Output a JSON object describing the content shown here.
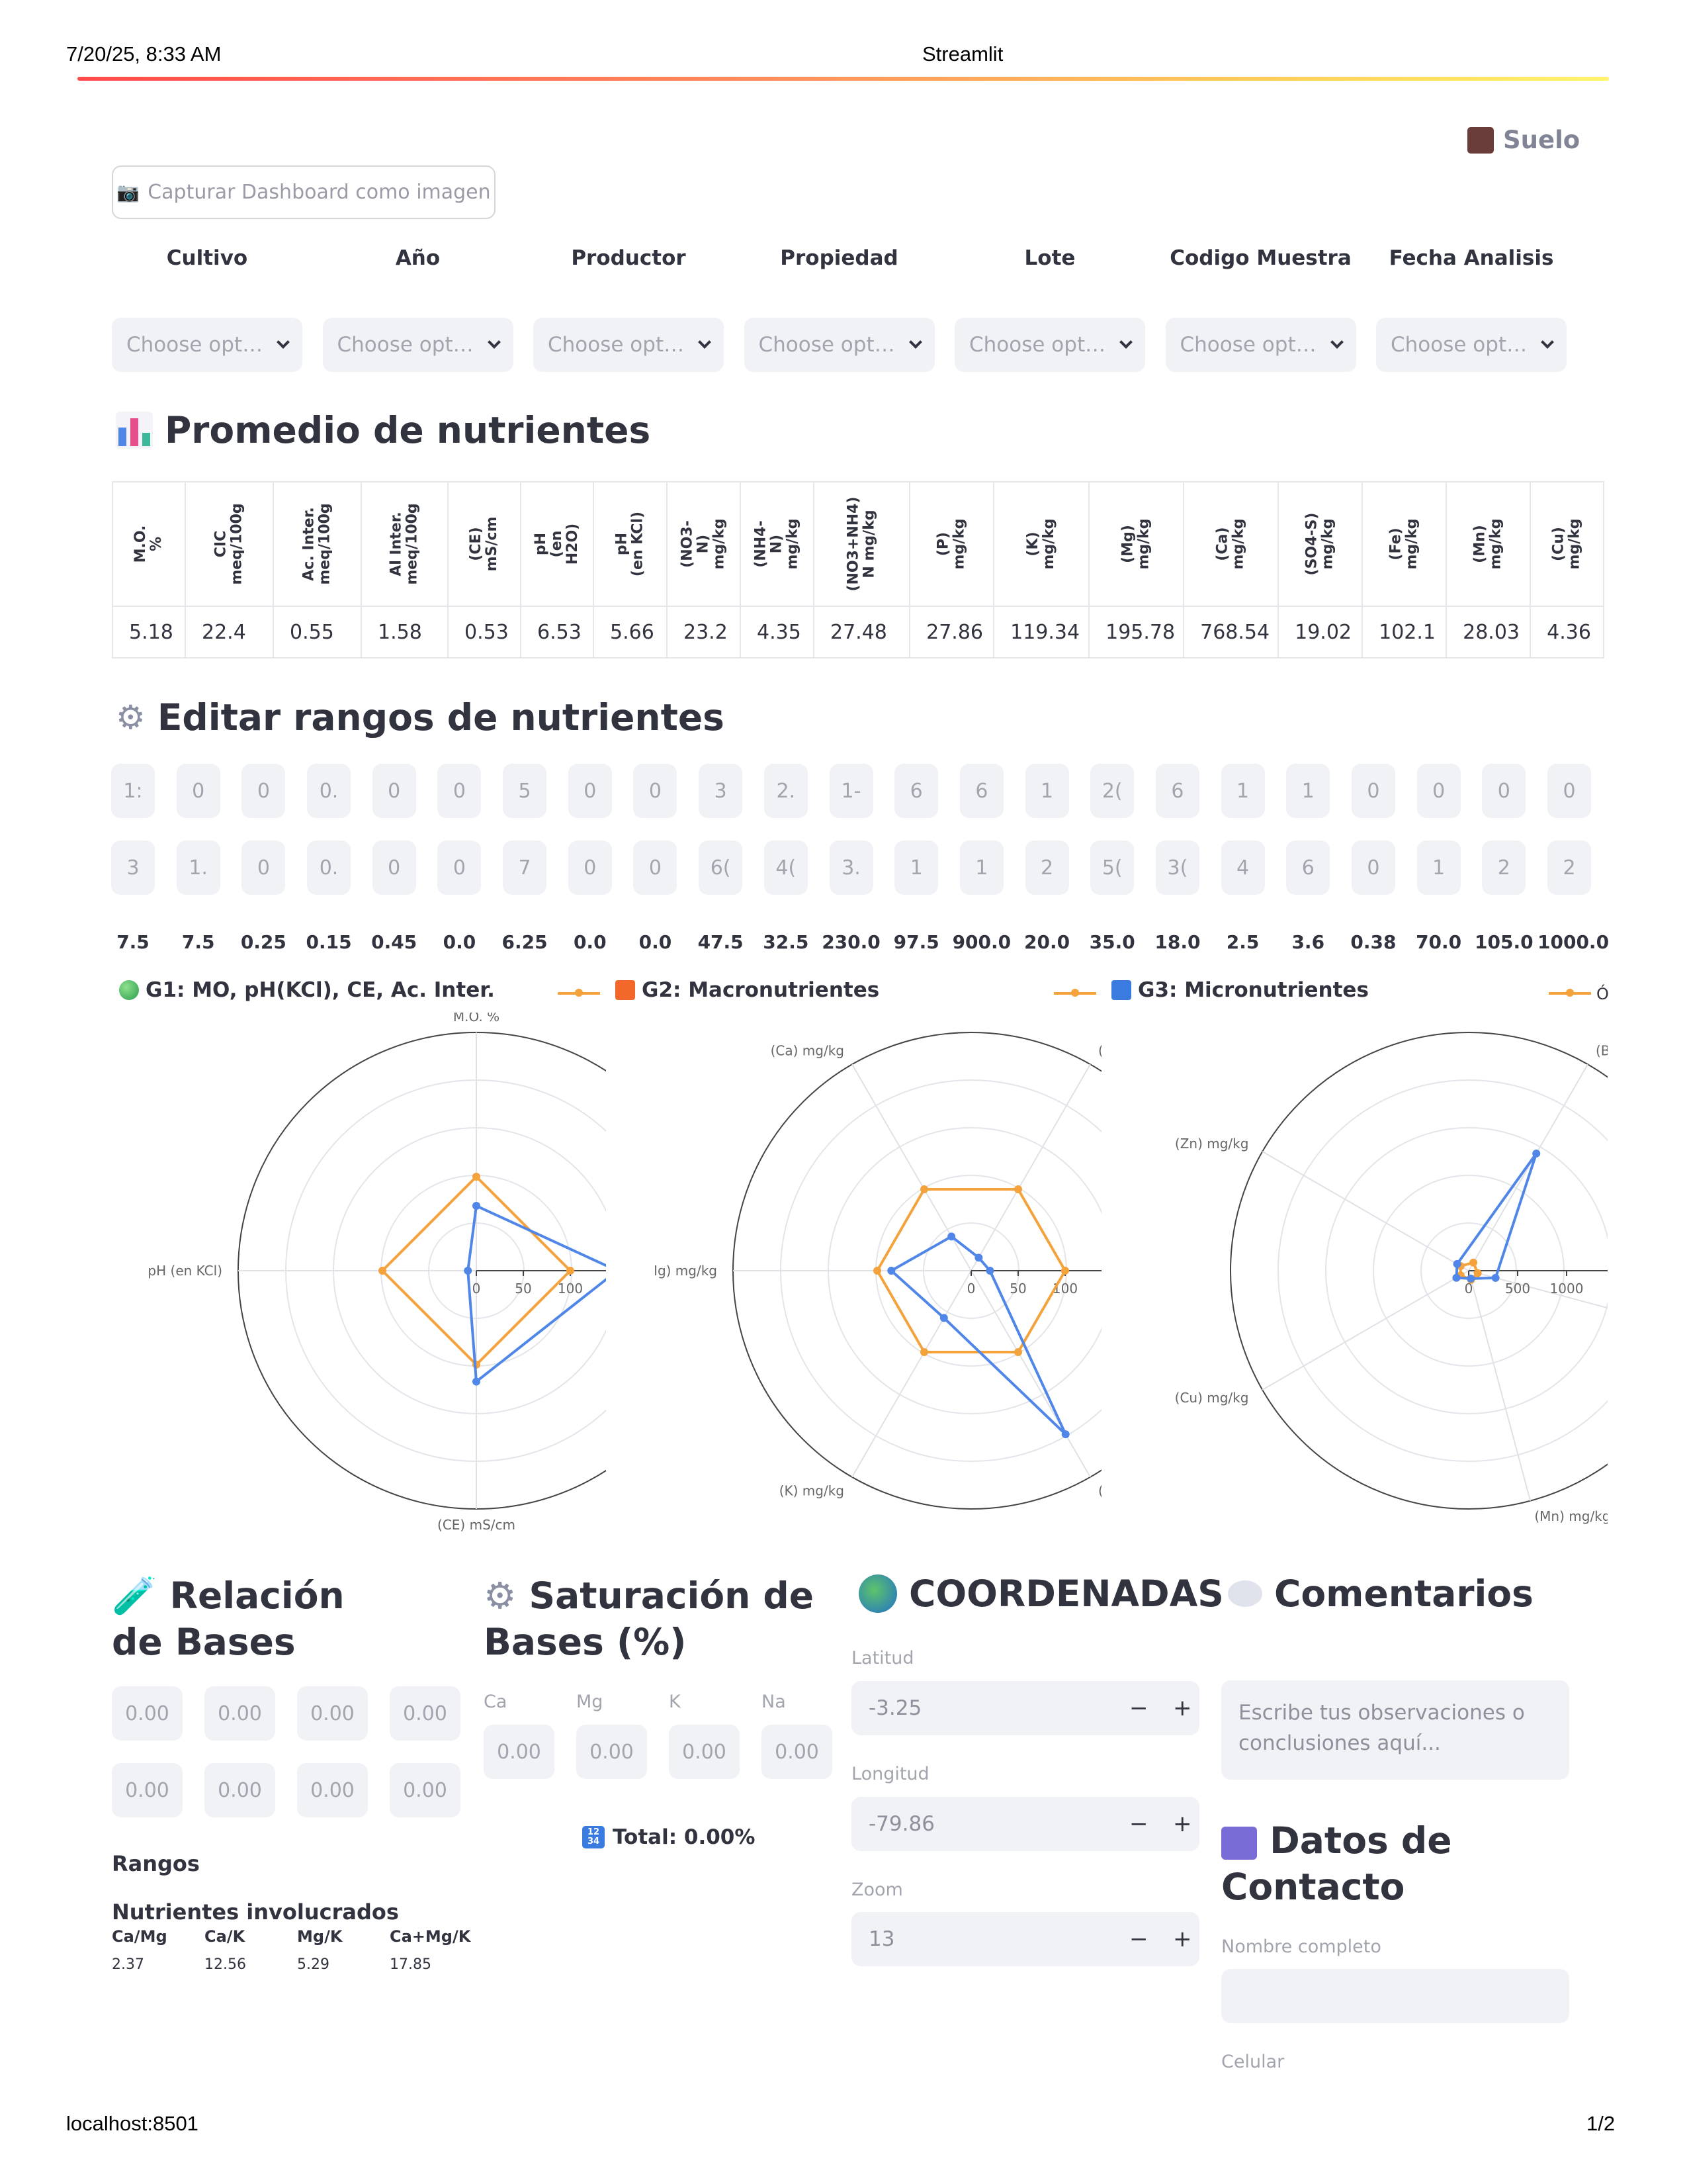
{
  "print": {
    "datetime": "7/20/25, 8:33 AM",
    "title": "Streamlit",
    "url": "localhost:8501",
    "page": "1/2"
  },
  "header": {
    "suelo_label": "Suelo",
    "capture_button": "Capturar Dashboard como imagen"
  },
  "filters": [
    {
      "label": "Cultivo",
      "placeholder": "Choose opt…"
    },
    {
      "label": "Año",
      "placeholder": "Choose opt…"
    },
    {
      "label": "Productor",
      "placeholder": "Choose opt…"
    },
    {
      "label": "Propiedad",
      "placeholder": "Choose opt…"
    },
    {
      "label": "Lote",
      "placeholder": "Choose opt…"
    },
    {
      "label": "Codigo Muestra",
      "placeholder": "Choose opt…"
    },
    {
      "label": "Fecha Analisis",
      "placeholder": "Choose opt…"
    }
  ],
  "promedio": {
    "title": "Promedio de nutrientes",
    "columns": [
      "M.O.\n%",
      "CIC\nmeq/100g",
      "Ac. Inter.\nmeq/100g",
      "Al Inter.\nmeq/100g",
      "(CE)\nmS/cm",
      "pH\n(en\nH2O)",
      "pH\n(en KCl)",
      "(NO3-\nN)\nmg/kg",
      "(NH4-\nN)\nmg/kg",
      "(NO3+NH4)\nN mg/kg",
      "(P)\nmg/kg",
      "(K)\nmg/kg",
      "(Mg)\nmg/kg",
      "(Ca)\nmg/kg",
      "(SO4-S)\nmg/kg",
      "(Fe)\nmg/kg",
      "(Mn)\nmg/kg",
      "(Cu)\nmg/kg"
    ],
    "values": [
      "5.18",
      "22.4",
      "0.55",
      "1.58",
      "0.53",
      "6.53",
      "5.66",
      "23.2",
      "4.35",
      "27.48",
      "27.86",
      "119.34",
      "195.78",
      "768.54",
      "19.02",
      "102.1",
      "28.03",
      "4.36"
    ]
  },
  "rangos_edit": {
    "title": "Editar rangos de nutrientes",
    "row_min": [
      "1:",
      "0",
      "0",
      "0.",
      "0",
      "0",
      "5",
      "0",
      "0",
      "3",
      "2.",
      "1-",
      "6",
      "6",
      "1",
      "2(",
      "6",
      "1",
      "1",
      "0",
      "0",
      "0",
      "0"
    ],
    "row_max": [
      "3",
      "1.",
      "0",
      "0.",
      "0",
      "0",
      "7",
      "0",
      "0",
      "6(",
      "4(",
      "3.",
      "1",
      "1",
      "2",
      "5(",
      "3(",
      "4",
      "6",
      "0",
      "1",
      "2",
      "2"
    ],
    "optimos": [
      "7.5",
      "7.5",
      "0.25",
      "0.15",
      "0.45",
      "0.0",
      "6.25",
      "0.0",
      "0.0",
      "47.5",
      "32.5",
      "230.0",
      "97.5",
      "900.0",
      "20.0",
      "35.0",
      "18.0",
      "2.5",
      "3.6",
      "0.38",
      "70.0",
      "105.0",
      "1000.0"
    ]
  },
  "radar_titles": {
    "g1": "G1: MO, pH(KCl), CE, Ac. Inter.",
    "g2": "G2: Macronutrientes",
    "g3": "G3: Micronutrientes",
    "g3_legend_clip": "Ó"
  },
  "chart_data": [
    {
      "type": "radar",
      "title": "G1: MO, pH(KCl), CE, Ac. Inter.",
      "axes": [
        "M.O. %",
        "pH  (en KCl)",
        "(CE) mS/cm"
      ],
      "radial_ticks": [
        "0",
        "50",
        "100"
      ],
      "series": [
        {
          "name": "Óptimo",
          "values": [
            100,
            100,
            100,
            100
          ],
          "color": "#f4a23c"
        },
        {
          "values": [
            69,
            9,
            118,
            150
          ],
          "color": "#4f86e8"
        }
      ]
    },
    {
      "type": "radar",
      "title": "G2: Macronutrientes",
      "axes": [
        "(Ca) mg/kg",
        "(S",
        "(Mg) mg/kg",
        "(K) mg/kg",
        "(P"
      ],
      "radial_ticks": [
        "0",
        "50",
        "100"
      ],
      "series": [
        {
          "name": "Óptimo",
          "values": [
            100,
            100,
            100,
            100,
            100,
            100
          ],
          "color": "#f4a23c"
        },
        {
          "values": [
            42,
            16,
            20,
            201,
            58,
            85
          ],
          "color": "#4f86e8"
        }
      ]
    },
    {
      "type": "radar",
      "title": "G3: Micronutrientes",
      "axes": [
        "(B)  mg/kg",
        "(Zn)  mg/kg",
        "(Cu) mg/kg",
        "(Mn) mg/kg"
      ],
      "radial_ticks": [
        "0",
        "500",
        "1000",
        "1"
      ],
      "series": [
        {
          "name": "Óptimo",
          "values": [
            100,
            100,
            100,
            100,
            100
          ],
          "color": "#f4a23c"
        },
        {
          "values": [
            1450,
            143,
            152,
            87,
            298
          ],
          "color": "#4f86e8"
        }
      ]
    }
  ],
  "relacion": {
    "title": "Relación de Bases",
    "inputs": [
      "0.00",
      "0.00",
      "0.00",
      "0.00",
      "0.00",
      "0.00",
      "0.00",
      "0.00"
    ],
    "rangos_label": "Rangos",
    "nutrientes_label": "Nutrientes involucrados",
    "ratios": [
      {
        "name": "Ca/Mg",
        "value": "2.37"
      },
      {
        "name": "Ca/K",
        "value": "12.56"
      },
      {
        "name": "Mg/K",
        "value": "5.29"
      },
      {
        "name": "Ca+Mg/K",
        "value": "17.85"
      }
    ]
  },
  "saturacion": {
    "title": "Saturación de Bases (%)",
    "fields": [
      {
        "label": "Ca",
        "value": "0.00"
      },
      {
        "label": "Mg",
        "value": "0.00"
      },
      {
        "label": "K",
        "value": "0.00"
      },
      {
        "label": "Na",
        "value": "0.00"
      }
    ],
    "total": "Total: 0.00%"
  },
  "coordenadas": {
    "title": "COORDENADAS",
    "latitud_label": "Latitud",
    "latitud": "-3.25",
    "longitud_label": "Longitud",
    "longitud": "-79.86",
    "zoom_label": "Zoom",
    "zoom": "13"
  },
  "comentarios": {
    "title": "Comentarios",
    "placeholder": "Escribe tus observaciones o conclusiones aquí..."
  },
  "contacto": {
    "title": "Datos de Contacto",
    "nombre_label": "Nombre completo",
    "celular_label": "Celular"
  },
  "colors": {
    "optimo": "#f4a23c",
    "valor": "#4f86e8",
    "suelo": "#6b3d3a"
  }
}
